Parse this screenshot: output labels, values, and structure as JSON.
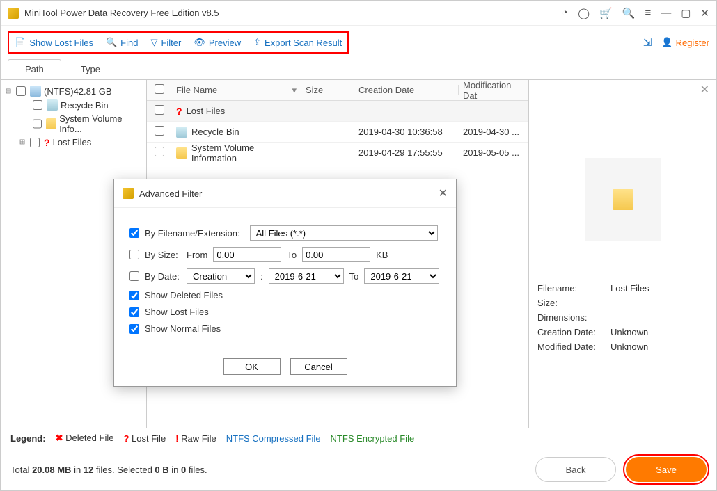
{
  "titlebar": {
    "app_title": "MiniTool Power Data Recovery Free Edition v8.5"
  },
  "toolbar": {
    "show_lost": "Show Lost Files",
    "find": "Find",
    "filter": "Filter",
    "preview": "Preview",
    "export": "Export Scan Result",
    "register": "Register"
  },
  "tabs": {
    "path": "Path",
    "type": "Type"
  },
  "tree": {
    "root": "(NTFS)42.81 GB",
    "recycle": "Recycle Bin",
    "sysvol": "System Volume Info...",
    "lost": "Lost Files"
  },
  "grid": {
    "cols": {
      "name": "File Name",
      "size": "Size",
      "cdate": "Creation Date",
      "mdate": "Modification Dat"
    },
    "rows": [
      {
        "name": "Lost Files",
        "size": "",
        "cdate": "",
        "mdate": ""
      },
      {
        "name": "Recycle Bin",
        "size": "",
        "cdate": "2019-04-30 10:36:58",
        "mdate": "2019-04-30 ..."
      },
      {
        "name": "System Volume Information",
        "size": "",
        "cdate": "2019-04-29 17:55:55",
        "mdate": "2019-05-05 ..."
      }
    ]
  },
  "preview": {
    "filename_lbl": "Filename:",
    "filename_val": "Lost Files",
    "size_lbl": "Size:",
    "size_val": "",
    "dim_lbl": "Dimensions:",
    "dim_val": "",
    "cdate_lbl": "Creation Date:",
    "cdate_val": "Unknown",
    "mdate_lbl": "Modified Date:",
    "mdate_val": "Unknown"
  },
  "dialog": {
    "title": "Advanced Filter",
    "by_filename": "By Filename/Extension:",
    "all_files": "All Files (*.*)",
    "by_size": "By Size:",
    "from": "From",
    "to": "To",
    "size_from": "0.00",
    "size_to": "0.00",
    "kb": "KB",
    "by_date": "By Date:",
    "date_type": "Creation",
    "colon": ":",
    "date_from": "2019-6-21",
    "date_to": "2019-6-21",
    "show_deleted": "Show Deleted Files",
    "show_lost": "Show Lost Files",
    "show_normal": "Show Normal Files",
    "ok": "OK",
    "cancel": "Cancel"
  },
  "legend": {
    "label": "Legend:",
    "deleted": "Deleted File",
    "lost": "Lost File",
    "raw": "Raw File",
    "ntfs_comp": "NTFS Compressed File",
    "ntfs_enc": "NTFS Encrypted File"
  },
  "status": {
    "text_pre": "Total ",
    "text_size": "20.08 MB",
    "text_mid": " in ",
    "text_files": "12",
    "text_post": " files.  Selected ",
    "sel_size": "0 B",
    "sel_mid": " in ",
    "sel_files": "0",
    "sel_post": " files.",
    "back": "Back",
    "save": "Save"
  }
}
